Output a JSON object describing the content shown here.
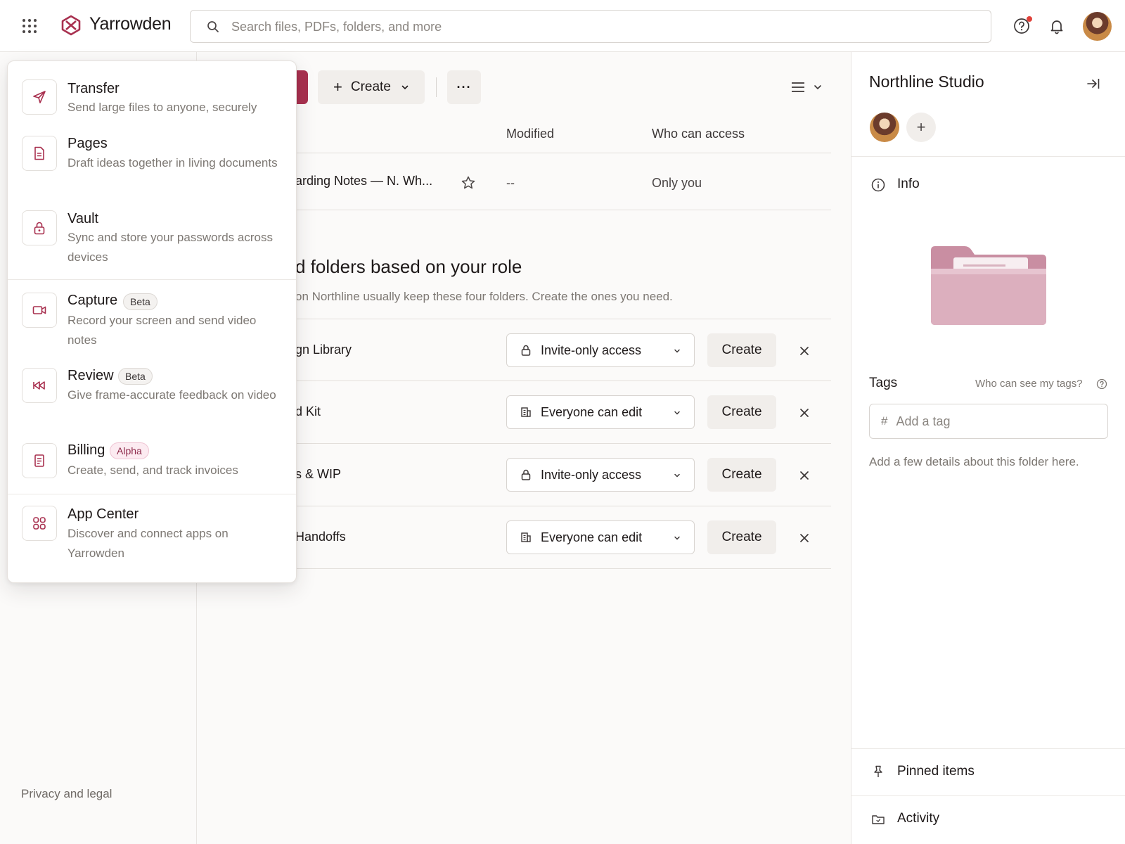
{
  "app": {
    "name": "Yarrowden"
  },
  "search": {
    "placeholder": "Search files, PDFs, folders, and more"
  },
  "toolbar": {
    "create_label": "Create",
    "more_label": "···"
  },
  "table": {
    "headers": {
      "modified": "Modified",
      "access": "Who can access"
    },
    "rows": [
      {
        "name": "arding Notes — N. Wh...",
        "modified": "--",
        "access": "Only you"
      }
    ]
  },
  "suggestions": {
    "title": "d folders based on your role",
    "subtitle": "on Northline usually keep these four folders. Create the ones you need.",
    "items": [
      {
        "name": "gn Library",
        "access": "Invite-only access",
        "access_icon": "lock-icon",
        "create": "Create"
      },
      {
        "name": "d Kit",
        "access": "Everyone can edit",
        "access_icon": "building-icon",
        "create": "Create"
      },
      {
        "name": "s & WIP",
        "access": "Invite-only access",
        "access_icon": "lock-icon",
        "create": "Create"
      },
      {
        "name": "Handoffs",
        "access": "Everyone can edit",
        "access_icon": "building-icon",
        "create": "Create"
      }
    ]
  },
  "sidebar": {
    "footer_link": "Privacy and legal"
  },
  "right_panel": {
    "title": "Northline Studio",
    "info_label": "Info",
    "tags_label": "Tags",
    "tags_help": "Who can see my tags?",
    "tag_placeholder": "Add a tag",
    "tag_hash": "#",
    "description_placeholder": "Add a few details about this folder here.",
    "pinned_label": "Pinned items",
    "activity_label": "Activity"
  },
  "app_menu": {
    "items": [
      {
        "title": "Transfer",
        "desc": "Send large files to anyone, securely",
        "icon": "send-icon"
      },
      {
        "title": "Pages",
        "desc": "Draft ideas together in living documents",
        "icon": "document-icon"
      },
      {
        "title": "Vault",
        "desc": "Sync and store your passwords across devices",
        "icon": "lock-icon"
      },
      {
        "title": "Capture",
        "badge": "Beta",
        "desc": "Record your screen and send video notes",
        "icon": "video-camera-icon"
      },
      {
        "title": "Review",
        "badge": "Beta",
        "desc": "Give frame-accurate feedback on video",
        "icon": "rewind-icon"
      },
      {
        "title": "Billing",
        "badge": "Alpha",
        "desc": "Create, send, and track invoices",
        "icon": "receipt-icon"
      },
      {
        "title": "App Center",
        "desc": "Discover and connect apps on Yarrowden",
        "icon": "apps-icon"
      }
    ]
  },
  "colors": {
    "brand": "#a8304f",
    "folder": "#d9a7b6",
    "alpha_badge": "#8e2a4b"
  }
}
